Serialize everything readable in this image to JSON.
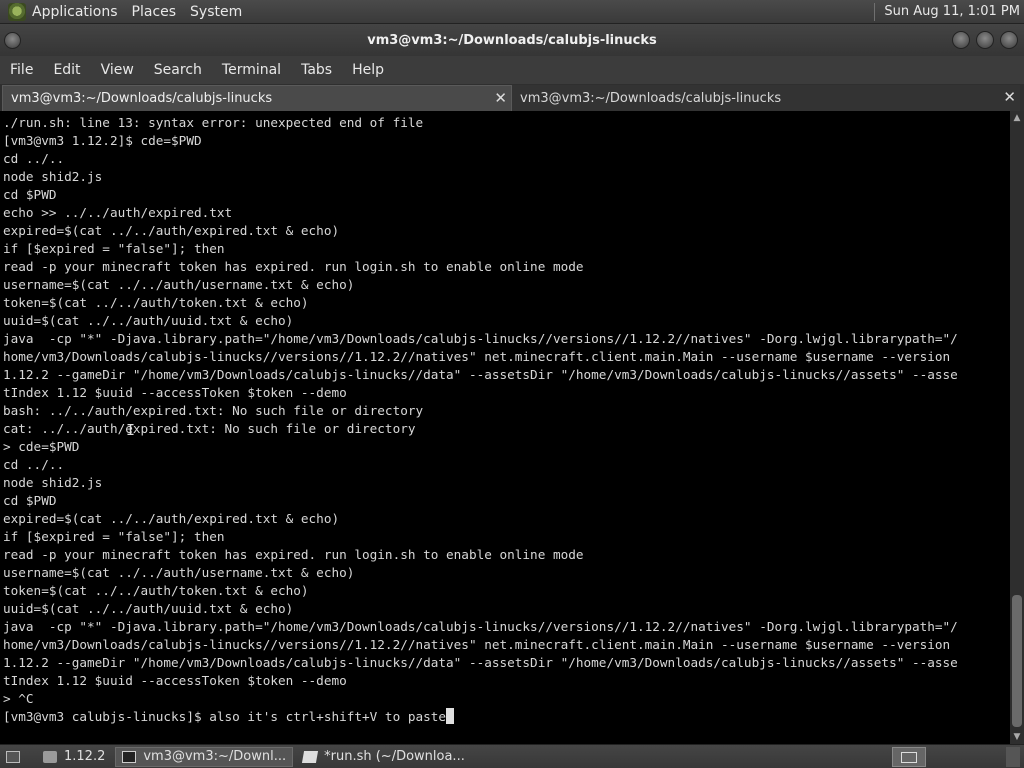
{
  "top_panel": {
    "menus": [
      "Applications",
      "Places",
      "System"
    ],
    "clock": "Sun Aug 11,  1:01 PM"
  },
  "window": {
    "title": "vm3@vm3:~/Downloads/calubjs-linucks",
    "menubar": [
      "File",
      "Edit",
      "View",
      "Search",
      "Terminal",
      "Tabs",
      "Help"
    ],
    "tabs": [
      {
        "label": "vm3@vm3:~/Downloads/calubjs-linucks",
        "active": true
      },
      {
        "label": "vm3@vm3:~/Downloads/calubjs-linucks",
        "active": false
      }
    ]
  },
  "terminal": {
    "lines": [
      "./run.sh: line 13: syntax error: unexpected end of file",
      "[vm3@vm3 1.12.2]$ cde=$PWD",
      "cd ../..",
      "node shid2.js",
      "cd $PWD",
      "echo >> ../../auth/expired.txt",
      "expired=$(cat ../../auth/expired.txt & echo)",
      "if [$expired = \"false\"]; then",
      "read -p your minecraft token has expired. run login.sh to enable online mode",
      "username=$(cat ../../auth/username.txt & echo)",
      "token=$(cat ../../auth/token.txt & echo)",
      "uuid=$(cat ../../auth/uuid.txt & echo)",
      "java  -cp \"*\" -Djava.library.path=\"/home/vm3/Downloads/calubjs-linucks//versions//1.12.2//natives\" -Dorg.lwjgl.librarypath=\"/",
      "home/vm3/Downloads/calubjs-linucks//versions//1.12.2//natives\" net.minecraft.client.main.Main --username $username --version",
      "1.12.2 --gameDir \"/home/vm3/Downloads/calubjs-linucks//data\" --assetsDir \"/home/vm3/Downloads/calubjs-linucks//assets\" --asse",
      "tIndex 1.12 $uuid --accessToken $token --demo",
      "bash: ../../auth/expired.txt: No such file or directory",
      "cat: ../../auth/expired.txt: No such file or directory",
      "> cde=$PWD",
      "cd ../..",
      "node shid2.js",
      "cd $PWD",
      "expired=$(cat ../../auth/expired.txt & echo)",
      "if [$expired = \"false\"]; then",
      "read -p your minecraft token has expired. run login.sh to enable online mode",
      "username=$(cat ../../auth/username.txt & echo)",
      "token=$(cat ../../auth/token.txt & echo)",
      "uuid=$(cat ../../auth/uuid.txt & echo)",
      "java  -cp \"*\" -Djava.library.path=\"/home/vm3/Downloads/calubjs-linucks//versions//1.12.2//natives\" -Dorg.lwjgl.librarypath=\"/",
      "home/vm3/Downloads/calubjs-linucks//versions//1.12.2//natives\" net.minecraft.client.main.Main --username $username --version",
      "1.12.2 --gameDir \"/home/vm3/Downloads/calubjs-linucks//data\" --assetsDir \"/home/vm3/Downloads/calubjs-linucks//assets\" --asse",
      "tIndex 1.12 $uuid --accessToken $token --demo",
      "> ^C"
    ],
    "prompt_line": "[vm3@vm3 calubjs-linucks]$ also it's ctrl+shift+V to paste"
  },
  "taskbar": {
    "items": [
      {
        "label": "1.12.2",
        "icon": "folder-icon",
        "active": false
      },
      {
        "label": "vm3@vm3:~/Downl...",
        "icon": "terminal-icon",
        "active": true
      },
      {
        "label": "*run.sh (~/Downloa...",
        "icon": "text-editor-icon",
        "active": false
      }
    ]
  }
}
